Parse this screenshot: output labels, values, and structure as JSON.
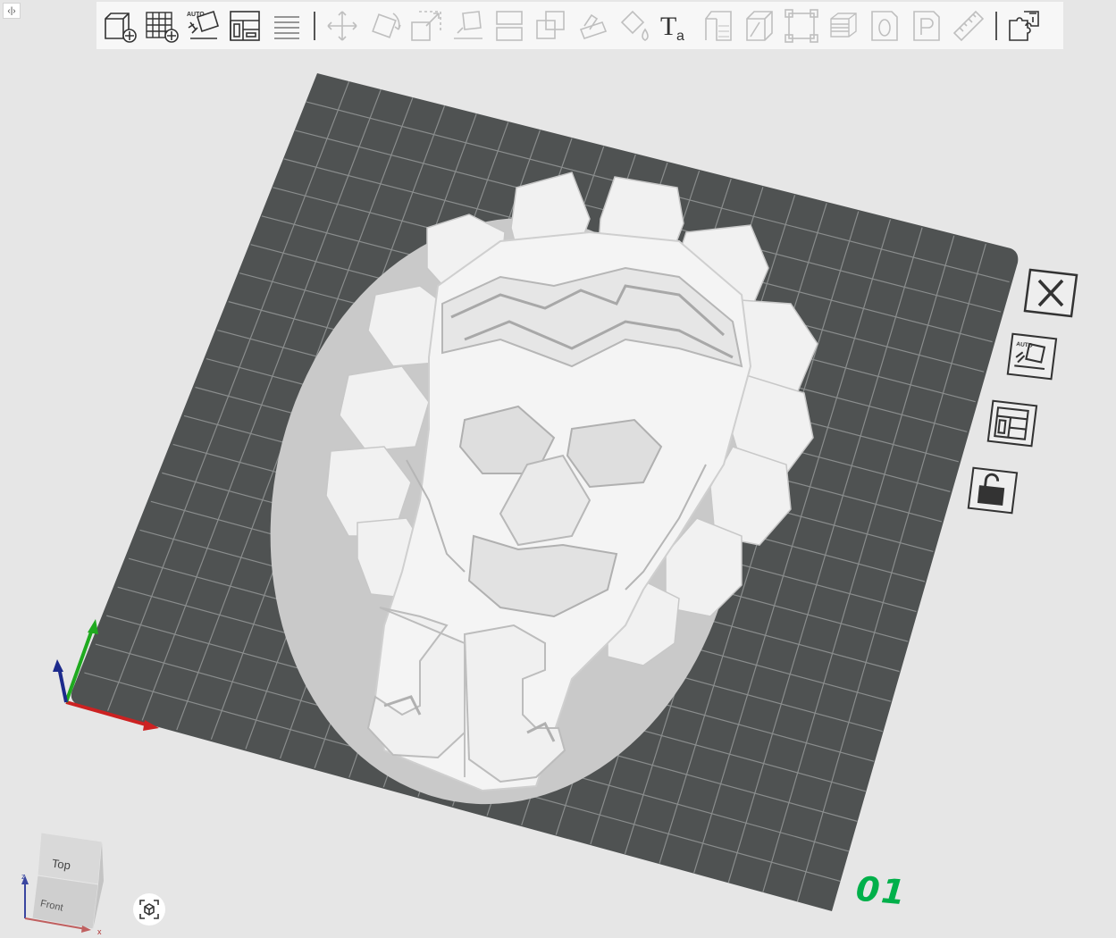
{
  "app": {
    "panel_toggle_glyph": "‹|›"
  },
  "toolbar": {
    "items": [
      {
        "icon": "add-object-icon",
        "enabled": true
      },
      {
        "icon": "add-plate-icon",
        "enabled": true
      },
      {
        "icon": "auto-orient-icon",
        "enabled": true,
        "badge": "AUTO"
      },
      {
        "icon": "arrange-icon",
        "enabled": true
      },
      {
        "icon": "split-plates-icon",
        "enabled": true
      },
      {
        "icon": "move-icon",
        "enabled": false
      },
      {
        "icon": "rotate-icon",
        "enabled": false
      },
      {
        "icon": "scale-icon",
        "enabled": false
      },
      {
        "icon": "lay-on-face-icon",
        "enabled": false
      },
      {
        "icon": "cut-icon",
        "enabled": false
      },
      {
        "icon": "mesh-boolean-icon",
        "enabled": false
      },
      {
        "icon": "support-paint-icon",
        "enabled": false
      },
      {
        "icon": "color-paint-icon",
        "enabled": false
      },
      {
        "icon": "text-emboss-icon",
        "enabled": true,
        "glyph": "Ta"
      },
      {
        "icon": "variable-layer-icon",
        "enabled": false
      },
      {
        "icon": "simplify-icon",
        "enabled": false
      },
      {
        "icon": "assembly-icon",
        "enabled": false
      },
      {
        "icon": "seam-paint-icon",
        "enabled": false
      },
      {
        "icon": "fuzzy-skin-icon",
        "enabled": false
      },
      {
        "icon": "brim-ears-icon",
        "enabled": false
      },
      {
        "icon": "measure-icon",
        "enabled": false
      },
      {
        "icon": "assembly-view-icon",
        "enabled": true
      }
    ]
  },
  "plate": {
    "number": "01",
    "buttons": [
      {
        "name": "delete-plate",
        "icon": "close-icon"
      },
      {
        "name": "auto-orient-plate",
        "icon": "auto-orient-icon",
        "badge": "AUTO"
      },
      {
        "name": "arrange-plate",
        "icon": "arrange-icon"
      },
      {
        "name": "lock-plate",
        "icon": "unlock-icon"
      }
    ]
  },
  "view_cube": {
    "top_label": "Top",
    "front_label": "Front",
    "z_label": "z",
    "x_label": "x"
  },
  "colors": {
    "background": "#e6e6e6",
    "plate": "#4f5252",
    "grid": "#878a8a",
    "model": "#f4f4f4",
    "plate_number": "#00b04a",
    "axis_x": "#cc2222",
    "axis_y": "#1faa1f",
    "axis_z": "#1c2a8c"
  }
}
